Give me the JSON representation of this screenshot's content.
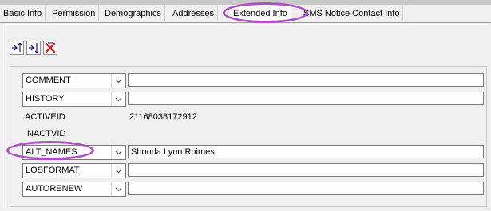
{
  "tabs": [
    {
      "label": "Basic Info",
      "active": false
    },
    {
      "label": "Permission",
      "active": false
    },
    {
      "label": "Demographics",
      "active": false
    },
    {
      "label": "Addresses",
      "active": false
    },
    {
      "label": "Extended Info",
      "active": true
    },
    {
      "label": "SMS Notice Contact Info",
      "active": false
    }
  ],
  "toolbar": {
    "icons": [
      "insert-row-above-icon",
      "insert-row-below-icon",
      "delete-row-icon"
    ]
  },
  "fields": [
    {
      "type": "select",
      "key": "COMMENT",
      "value": ""
    },
    {
      "type": "select",
      "key": "HISTORY",
      "value": ""
    },
    {
      "type": "static",
      "key": "ACTIVEID",
      "value": "21168038172912"
    },
    {
      "type": "static",
      "key": "INACTVID",
      "value": ""
    },
    {
      "type": "select",
      "key": "ALT_NAMES",
      "value": "Shonda Lynn Rhimes"
    },
    {
      "type": "select",
      "key": "LOSFORMAT",
      "value": ""
    },
    {
      "type": "select",
      "key": "AUTORENEW",
      "value": ""
    }
  ],
  "colors": {
    "annotation_ring": "#b04fc4",
    "delete_icon": "#d4201c"
  }
}
